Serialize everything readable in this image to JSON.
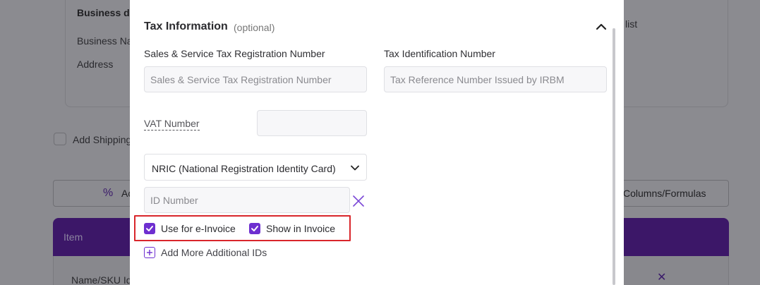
{
  "background": {
    "business_card_title": "Business de",
    "business_name_label": "Business Na",
    "address_label": "Address",
    "list_fragment": "list",
    "add_shipping_label": "Add Shipping",
    "left_button_label": "Ac",
    "right_button_label": "Columns/Formulas",
    "table_header_item": "Item",
    "table_row_name_label": "Name/SKU Id",
    "colors": {
      "table_header": "#3c1768",
      "overlay": "#8b8b90"
    }
  },
  "modal": {
    "section": {
      "title": "Tax Information",
      "optional": "(optional)",
      "collapse_icon": "chevron-up-icon"
    },
    "sst": {
      "label": "Sales & Service Tax Registration Number",
      "value": "",
      "placeholder": "Sales & Service Tax Registration Number"
    },
    "tin": {
      "label": "Tax Identification Number",
      "value": "",
      "placeholder": "Tax Reference Number Issued by IRBM"
    },
    "vat": {
      "label": "VAT Number",
      "value": "",
      "placeholder": ""
    },
    "id_type": {
      "selected": "NRIC (National Registration Identity Card)",
      "icon": "chevron-down-icon"
    },
    "id_number": {
      "value": "",
      "placeholder": "ID Number",
      "remove_icon": "close-icon"
    },
    "checkboxes": [
      {
        "label": "Use for e-Invoice",
        "checked": true
      },
      {
        "label": "Show in Invoice",
        "checked": true
      }
    ],
    "add_more": {
      "label": "Add More Additional IDs",
      "icon": "plus-square-icon"
    },
    "colors": {
      "accent": "#6e2fd0",
      "highlight_border": "#d9262b",
      "input_bg": "#f7f7f9"
    }
  }
}
